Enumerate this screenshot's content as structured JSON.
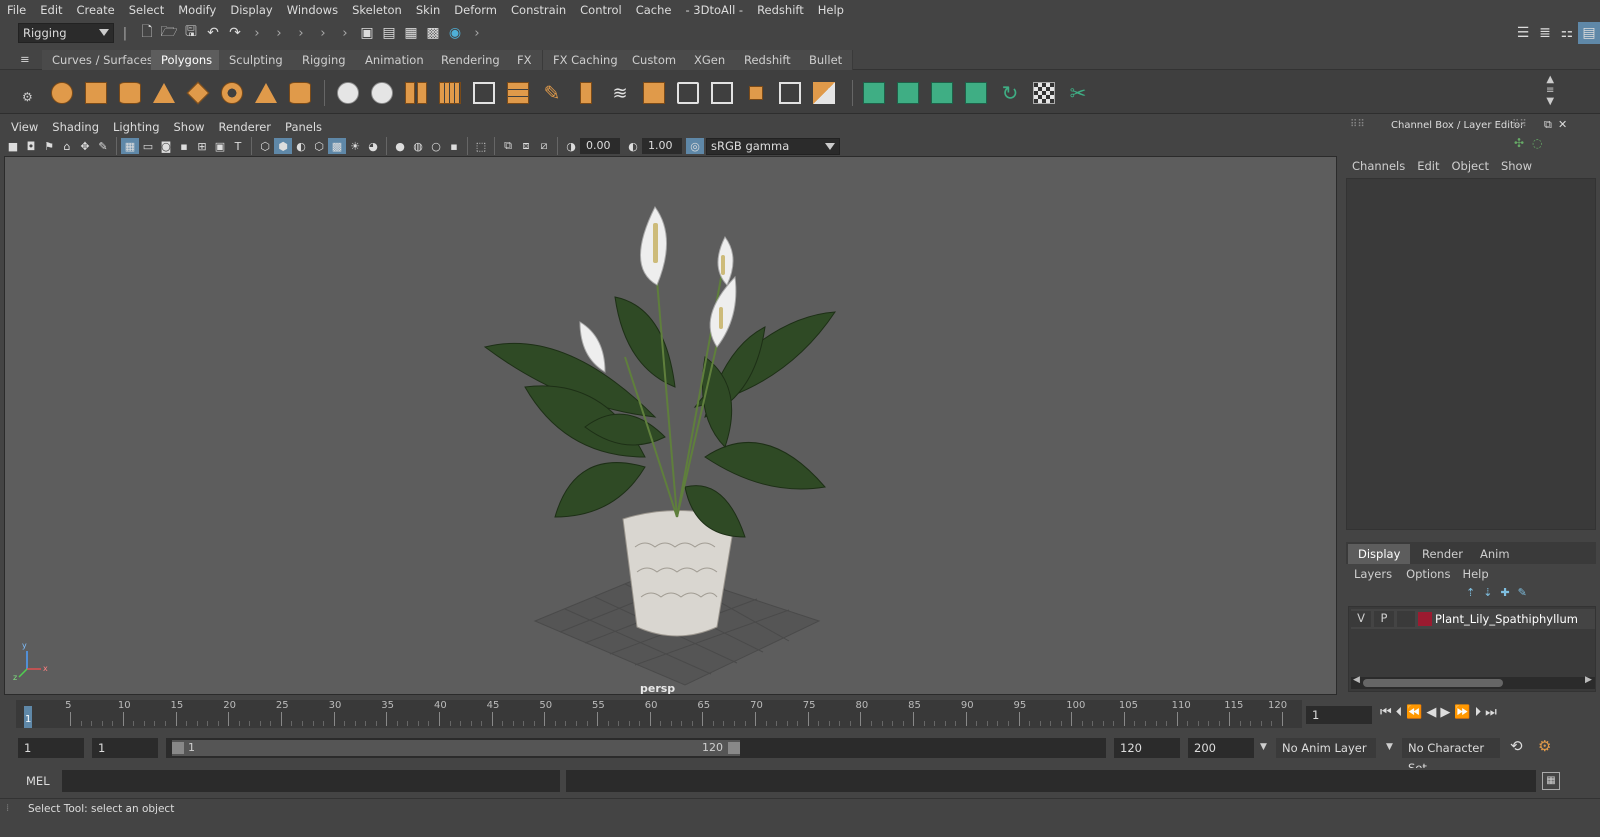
{
  "menus": [
    "File",
    "Edit",
    "Create",
    "Select",
    "Modify",
    "Display",
    "Windows",
    "Skeleton",
    "Skin",
    "Deform",
    "Constrain",
    "Control",
    "Cache",
    "- 3DtoAll -",
    "Redshift",
    "Help"
  ],
  "menuset": {
    "value": "Rigging"
  },
  "shelf_tabs": [
    {
      "label": "Curves / Surfaces"
    },
    {
      "label": "Polygons"
    },
    {
      "label": "Sculpting"
    },
    {
      "label": "Rigging"
    },
    {
      "label": "Animation"
    },
    {
      "label": "Rendering"
    },
    {
      "label": "FX"
    },
    {
      "label": "FX Caching"
    },
    {
      "label": "Custom"
    },
    {
      "label": "XGen"
    },
    {
      "label": "Redshift"
    },
    {
      "label": "Bullet"
    }
  ],
  "active_shelf_tab": "Polygons",
  "viewport": {
    "menus": [
      "View",
      "Shading",
      "Lighting",
      "Show",
      "Renderer",
      "Panels"
    ],
    "exposure": "0.00",
    "gamma": "1.00",
    "color_space": "sRGB gamma",
    "camera_label": "persp",
    "axis_labels": {
      "x": "x",
      "y": "y",
      "z": "z"
    }
  },
  "channel_box": {
    "title": "Channel Box / Layer Editor",
    "menus": [
      "Channels",
      "Edit",
      "Object",
      "Show"
    ]
  },
  "layer_editor": {
    "tabs": [
      "Display",
      "Render",
      "Anim"
    ],
    "active_tab": "Display",
    "menus": [
      "Layers",
      "Options",
      "Help"
    ],
    "layers": [
      {
        "visible": "V",
        "playback": "P",
        "name": "Plant_Lily_Spathiphyllum",
        "color": "#9b1b30"
      }
    ]
  },
  "timeline": {
    "ticks": [
      "1",
      "5",
      "10",
      "15",
      "20",
      "25",
      "30",
      "35",
      "40",
      "45",
      "50",
      "55",
      "60",
      "65",
      "70",
      "75",
      "80",
      "85",
      "90",
      "95",
      "100",
      "105",
      "110",
      "115",
      "120"
    ],
    "current_frame": "1"
  },
  "range": {
    "start": "1",
    "playback_start": "1",
    "slider_start": "1",
    "slider_end": "120",
    "playback_end": "120",
    "end": "200",
    "anim_layer": "No Anim Layer",
    "character_set": "No Character Set"
  },
  "command_line": {
    "label": "MEL"
  },
  "help_line": "Select Tool: select an object",
  "colors": {
    "accent": "#5f88a8",
    "layer_color": "#9b1b30",
    "orange_icon": "#e09a4a",
    "green_icon": "#3fae84"
  }
}
